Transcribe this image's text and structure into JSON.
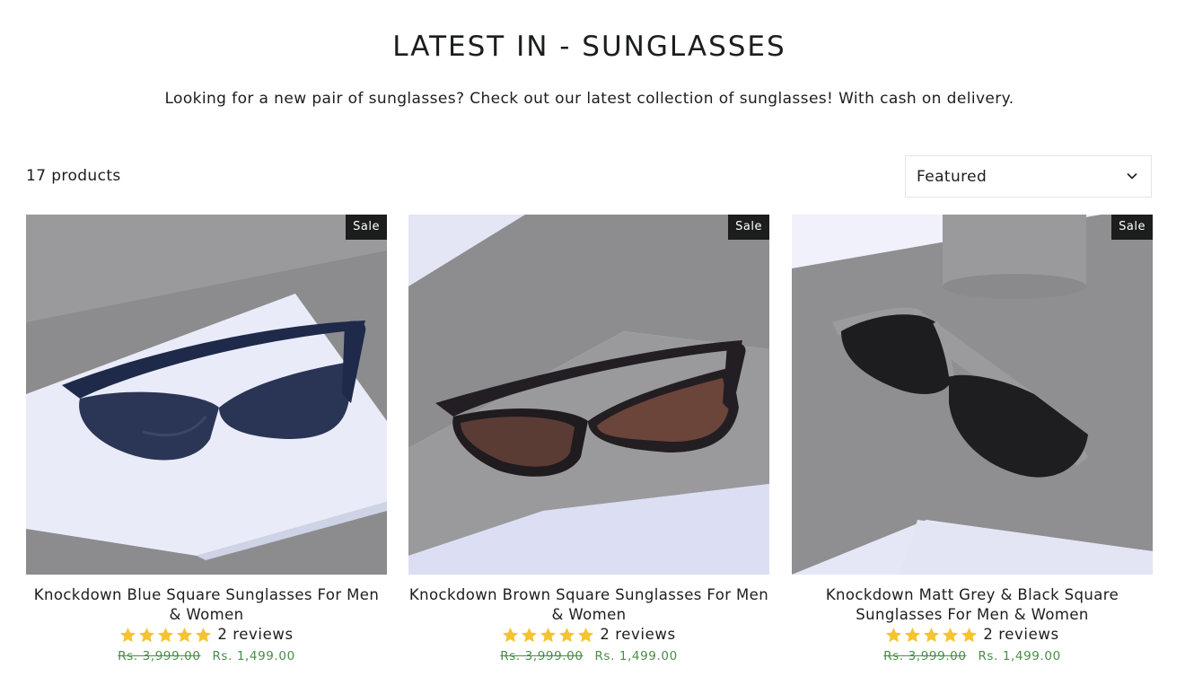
{
  "collection": {
    "title": "LATEST IN - SUNGLASSES",
    "description": "Looking for a new pair of sunglasses? Check out our latest collection of sunglasses! With cash on delivery.",
    "product_count": "17 products",
    "sort_label": "Featured"
  },
  "colors": {
    "sale_badge_bg": "#1c1d1d",
    "price": "#4a8c4a",
    "star": "#f4c430"
  },
  "products": [
    {
      "badge": "Sale",
      "name": "Knockdown Blue Square Sunglasses For Men & Women",
      "rating": 5,
      "reviews": "2 reviews",
      "compare_price": "Rs. 3,999.00",
      "price": "Rs. 1,499.00"
    },
    {
      "badge": "Sale",
      "name": "Knockdown Brown Square Sunglasses For Men & Women",
      "rating": 5,
      "reviews": "2 reviews",
      "compare_price": "Rs. 3,999.00",
      "price": "Rs. 1,499.00"
    },
    {
      "badge": "Sale",
      "name": "Knockdown Matt Grey & Black Square Sunglasses For Men & Women",
      "rating": 5,
      "reviews": "2 reviews",
      "compare_price": "Rs. 3,999.00",
      "price": "Rs. 1,499.00"
    }
  ]
}
